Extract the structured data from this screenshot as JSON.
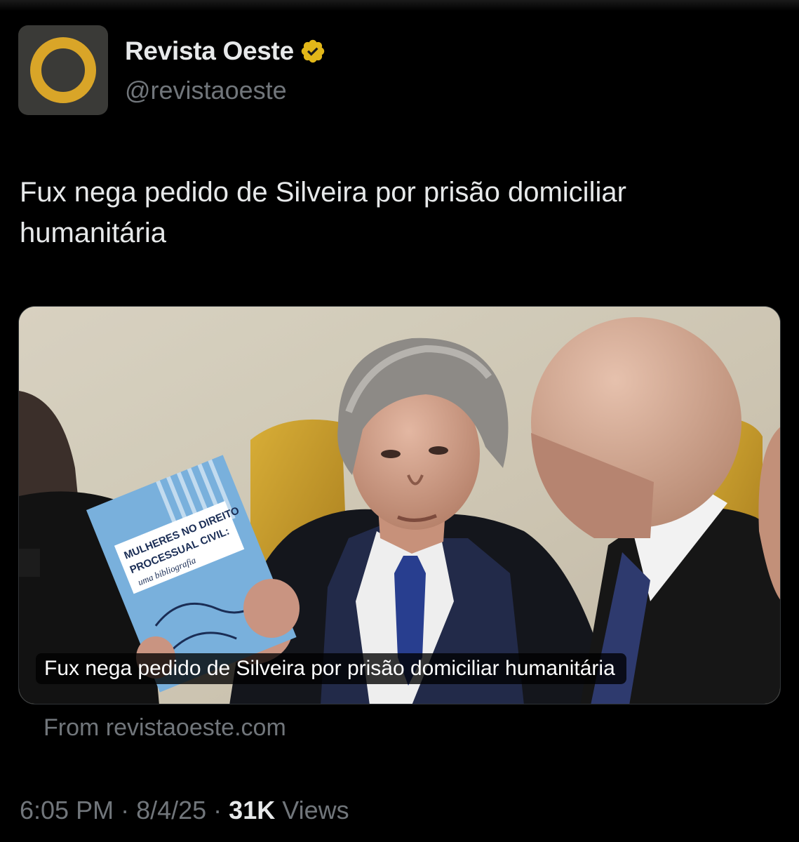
{
  "colors": {
    "background": "#000000",
    "text_primary": "#e7e9ea",
    "text_secondary": "#71767b",
    "avatar_bg": "#3a3a37",
    "brand_gold": "#d9a528",
    "verified_gold": "#e2b719"
  },
  "author": {
    "display_name": "Revista Oeste",
    "handle": "@revistaoeste",
    "avatar_icon": "revista-oeste-logo",
    "verified_icon": "verified-badge-gold"
  },
  "tweet": {
    "text": "Fux nega pedido de Silveira por prisão domiciliar humanitária"
  },
  "card": {
    "caption": "Fux nega pedido de Silveira por prisão domiciliar humanitária",
    "source": "From revistaoeste.com",
    "book_title_line1": "MULHERES NO DIREITO",
    "book_title_line2": "PROCESSUAL CIVIL:",
    "book_subtitle": "uma bibliografia"
  },
  "meta": {
    "time": "6:05 PM",
    "separator": " · ",
    "date": "8/4/25",
    "views_count": "31K",
    "views_label": "Views"
  }
}
